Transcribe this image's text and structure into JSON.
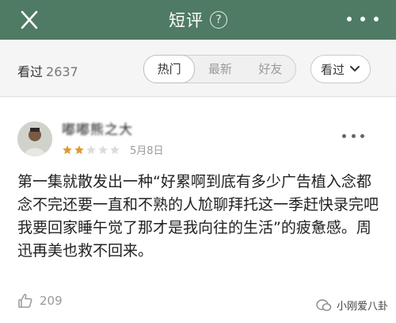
{
  "header": {
    "title": "短评",
    "help_glyph": "?",
    "close_icon": "close-icon",
    "more_icon": "more-dots-icon",
    "bg_color": "#4f7a63"
  },
  "filter": {
    "seen_label": "看过",
    "seen_count": "2637",
    "tabs": [
      {
        "label": "热门",
        "active": true
      },
      {
        "label": "最新",
        "active": false
      },
      {
        "label": "好友",
        "active": false
      }
    ],
    "dropdown_label": "看过"
  },
  "review": {
    "username": "嘟嘟熊之大",
    "rating": 2,
    "rating_max": 5,
    "star_color": "#e09a2d",
    "date": "5月8日",
    "text": "第一集就散发出一种“好累啊到底有多少广告植入念都念不完还要一直和不熟的人尬聊拜托这一季赶快录完吧我要回家睡午觉了那才是我向往的生活”的疲惫感。周迅再美也救不回来。",
    "like_count": "209"
  },
  "watermark": {
    "text": "小刚爱八卦"
  }
}
